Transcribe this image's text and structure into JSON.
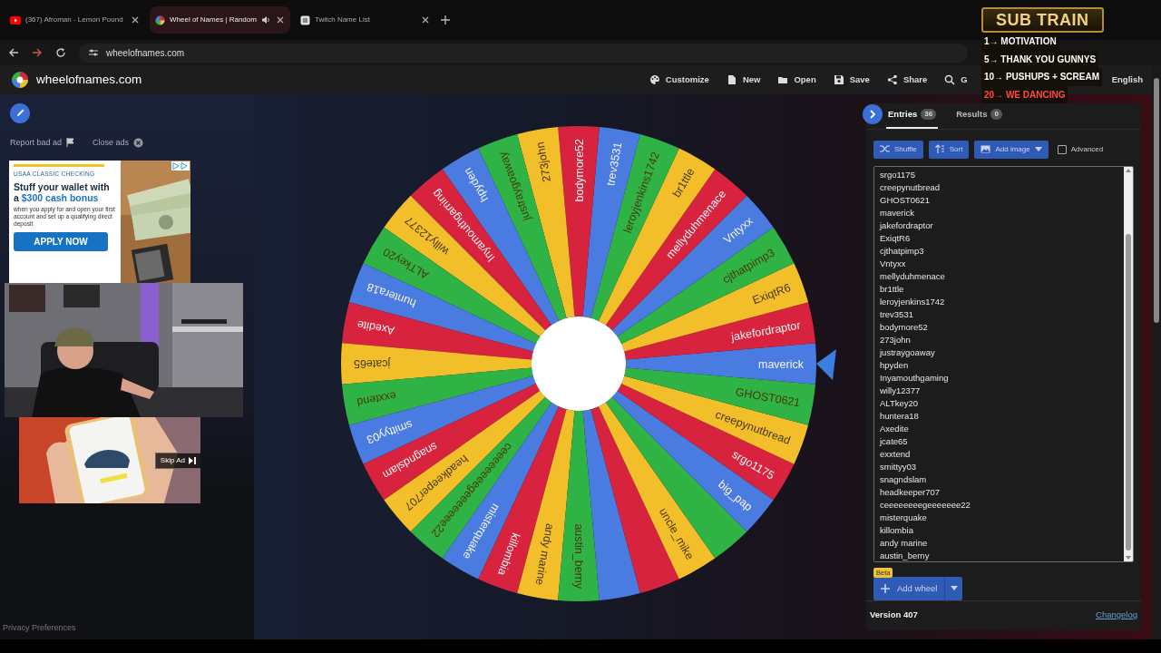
{
  "browser": {
    "tabs": [
      {
        "title": "(367) Afroman - Lemon Pound",
        "selected": false,
        "audio": false
      },
      {
        "title": "Wheel of Names | Random",
        "selected": true,
        "audio": true
      },
      {
        "title": "Twitch Name List",
        "selected": false,
        "audio": false
      }
    ],
    "url": "wheelofnames.com"
  },
  "site": {
    "brand": "wheelofnames.com",
    "nav": [
      {
        "label": "Customize"
      },
      {
        "label": "New"
      },
      {
        "label": "Open"
      },
      {
        "label": "Save"
      },
      {
        "label": "Share"
      },
      {
        "label": "G"
      }
    ],
    "language": "English"
  },
  "ads": {
    "report": "Report bad ad",
    "close": "Close ads",
    "banner": {
      "eyebrow": "USAA CLASSIC CHECKING",
      "headline": "Stuff your wallet with a",
      "highlight": "$300 cash bonus",
      "body": "when you apply for and open your first account and set up a qualifying direct deposit",
      "cta": "APPLY NOW"
    },
    "video_ad": {
      "skip": "Skip Ad"
    }
  },
  "privacy": "Privacy Preferences",
  "wheel": {
    "segments": [
      {
        "label": "maverick",
        "color": "#4a7be0"
      },
      {
        "label": "jakefordraptor",
        "color": "#d8233f"
      },
      {
        "label": "ExiqtR6",
        "color": "#f2be2a"
      },
      {
        "label": "cjthatpimp3",
        "color": "#2fb344"
      },
      {
        "label": "Vntyxx",
        "color": "#4a7be0"
      },
      {
        "label": "mellyduhmenace",
        "color": "#d8233f"
      },
      {
        "label": "br1ttle",
        "color": "#f2be2a"
      },
      {
        "label": "leroyjenkins1742",
        "color": "#2fb344"
      },
      {
        "label": "trev3531",
        "color": "#4a7be0"
      },
      {
        "label": "bodymore52",
        "color": "#d8233f"
      },
      {
        "label": "273john",
        "color": "#f2be2a"
      },
      {
        "label": "justraygoaway",
        "color": "#2fb344"
      },
      {
        "label": "hpyden",
        "color": "#4a7be0"
      },
      {
        "label": "Inyamouthgaming",
        "color": "#d8233f"
      },
      {
        "label": "willy12377",
        "color": "#f2be2a"
      },
      {
        "label": "ALTkey20",
        "color": "#2fb344"
      },
      {
        "label": "huntera18",
        "color": "#4a7be0"
      },
      {
        "label": "Axedite",
        "color": "#d8233f"
      },
      {
        "label": "jcate65",
        "color": "#f2be2a"
      },
      {
        "label": "exxtend",
        "color": "#2fb344"
      },
      {
        "label": "smittyy03",
        "color": "#4a7be0"
      },
      {
        "label": "snagndslam",
        "color": "#d8233f"
      },
      {
        "label": "headkeeper707",
        "color": "#f2be2a"
      },
      {
        "label": "ceeeeeeeegeeeeeee22",
        "color": "#2fb344"
      },
      {
        "label": "misterquake",
        "color": "#4a7be0"
      },
      {
        "label": "killombia",
        "color": "#d8233f"
      },
      {
        "label": "andy marine",
        "color": "#f2be2a"
      },
      {
        "label": "austin_berny",
        "color": "#2fb344"
      },
      {
        "color": "#4a7be0"
      },
      {
        "color": "#d8233f"
      },
      {
        "label": "uncle_mike",
        "color": "#f2be2a"
      },
      {
        "color": "#2fb344"
      },
      {
        "label": "big_pap",
        "color": "#4a7be0"
      },
      {
        "label": "srgo1175",
        "color": "#d8233f"
      },
      {
        "label": "creepynutbread",
        "color": "#f2be2a"
      },
      {
        "label": "GHOST0621",
        "color": "#2fb344"
      }
    ]
  },
  "panel": {
    "tabs": [
      {
        "label": "Entries",
        "count": "36",
        "selected": true
      },
      {
        "label": "Results",
        "count": "0",
        "selected": false
      }
    ],
    "tools": [
      {
        "label": "Shuffle",
        "dropdown": false
      },
      {
        "label": "Sort",
        "dropdown": false
      },
      {
        "label": "Add image",
        "dropdown": true
      }
    ],
    "advanced": {
      "label": "Advanced",
      "checked": false
    },
    "entries": [
      "srgo1175",
      "creepynutbread",
      "GHOST0621",
      "maverick",
      "jakefordraptor",
      "ExiqtR6",
      "cjthatpimp3",
      "Vntyxx",
      "mellyduhmenace",
      "br1ttle",
      "leroyjenkins1742",
      "trev3531",
      "bodymore52",
      "273john",
      "justraygoaway",
      "hpyden",
      "Inyamouthgaming",
      "willy12377",
      "ALTkey20",
      "huntera18",
      "Axedite",
      "jcate65",
      "exxtend",
      "smittyy03",
      "snagndslam",
      "headkeeper707",
      "ceeeeeeeegeeeeeee22",
      "misterquake",
      "killombia",
      "andy marine",
      "austin_berny"
    ],
    "add_wheel": {
      "badge": "Beta",
      "label": "Add wheel"
    },
    "version": "Version 407",
    "changelog": "Changelog"
  },
  "overlay": {
    "title": "SUB TRAIN",
    "goals": [
      {
        "text": "1→ MOTIVATION",
        "highlight": false
      },
      {
        "text": "5→ THANK YOU GUNNYS",
        "highlight": false
      },
      {
        "text": "10→ PUSHUPS + SCREAM",
        "highlight": false
      },
      {
        "text": "20→ WE DANCING",
        "highlight": true
      }
    ]
  }
}
